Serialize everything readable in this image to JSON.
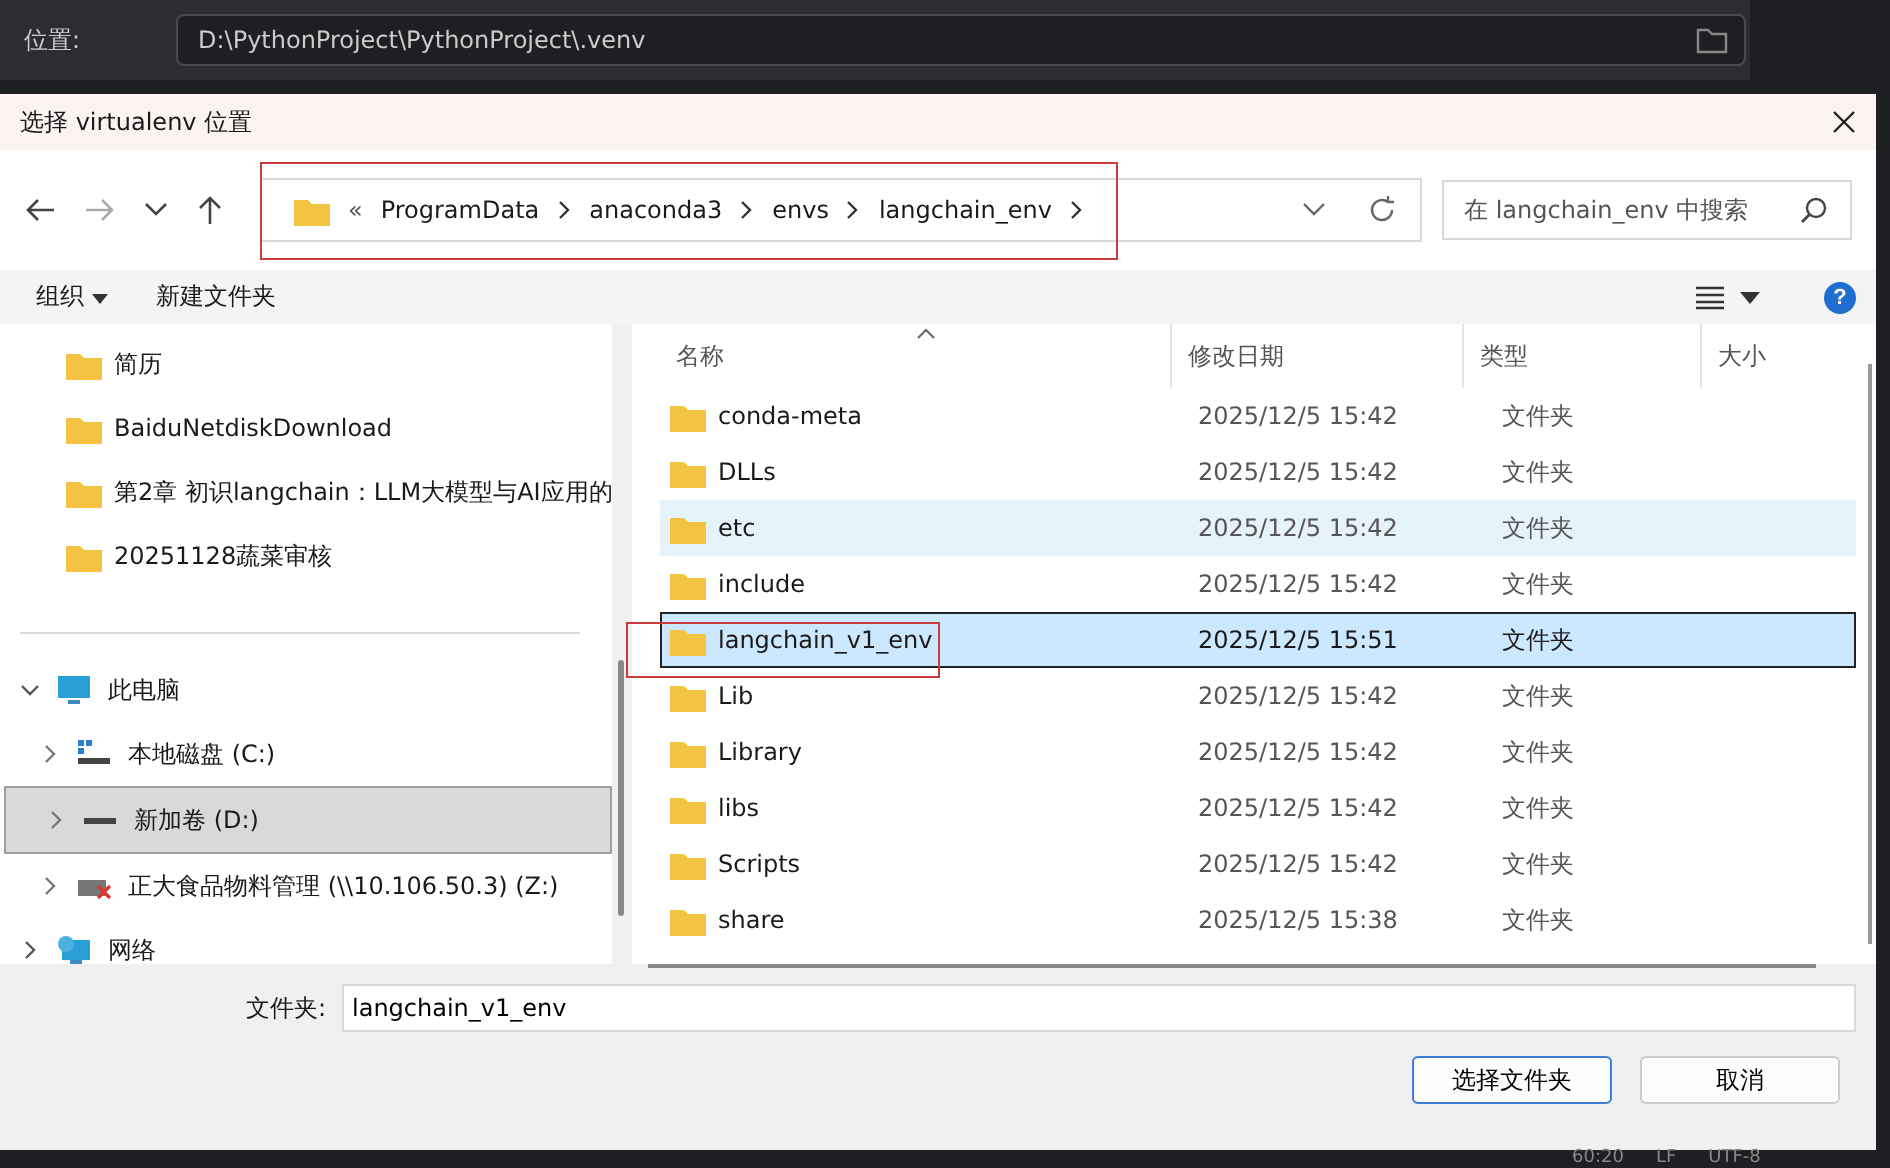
{
  "ide": {
    "location_label": "位置:",
    "location_value": "D:\\PythonProject\\PythonProject\\.venv"
  },
  "dialog": {
    "title": "选择 virtualenv 位置",
    "overflow": "«",
    "breadcrumb": [
      "ProgramData",
      "anaconda3",
      "envs",
      "langchain_env"
    ],
    "search": {
      "placeholder": "在 langchain_env 中搜索"
    },
    "toolbar": {
      "organize": "组织",
      "new_folder": "新建文件夹",
      "help": "?"
    },
    "quick_access": [
      {
        "label": "简历"
      },
      {
        "label": "BaiduNetdiskDownload"
      },
      {
        "label": "第2章 初识langchain：LLM大模型与AI应用的"
      },
      {
        "label": "20251128蔬菜审核"
      }
    ],
    "tree": [
      {
        "label": "此电脑",
        "kind": "pc",
        "expanded": true,
        "selected": false,
        "children": [
          {
            "label": "本地磁盘 (C:)",
            "kind": "system-drive",
            "expanded": false,
            "selected": false
          },
          {
            "label": "新加卷 (D:)",
            "kind": "drive",
            "expanded": false,
            "selected": true
          },
          {
            "label": "正大食品物料管理 (\\\\10.106.50.3) (Z:)",
            "kind": "network-drive",
            "expanded": false,
            "selected": false
          }
        ]
      },
      {
        "label": "网络",
        "kind": "network",
        "expanded": false,
        "selected": false
      }
    ],
    "columns": [
      "名称",
      "修改日期",
      "类型",
      "大小"
    ],
    "rows": [
      {
        "name": "conda-meta",
        "date": "2025/12/5 15:42",
        "type": "文件夹",
        "selected": false,
        "hovered": false
      },
      {
        "name": "DLLs",
        "date": "2025/12/5 15:42",
        "type": "文件夹",
        "selected": false,
        "hovered": false
      },
      {
        "name": "etc",
        "date": "2025/12/5 15:42",
        "type": "文件夹",
        "selected": false,
        "hovered": true
      },
      {
        "name": "include",
        "date": "2025/12/5 15:42",
        "type": "文件夹",
        "selected": false,
        "hovered": false
      },
      {
        "name": "langchain_v1_env",
        "date": "2025/12/5 15:51",
        "type": "文件夹",
        "selected": true,
        "hovered": false
      },
      {
        "name": "Lib",
        "date": "2025/12/5 15:42",
        "type": "文件夹",
        "selected": false,
        "hovered": false
      },
      {
        "name": "Library",
        "date": "2025/12/5 15:42",
        "type": "文件夹",
        "selected": false,
        "hovered": false
      },
      {
        "name": "libs",
        "date": "2025/12/5 15:42",
        "type": "文件夹",
        "selected": false,
        "hovered": false
      },
      {
        "name": "Scripts",
        "date": "2025/12/5 15:42",
        "type": "文件夹",
        "selected": false,
        "hovered": false
      },
      {
        "name": "share",
        "date": "2025/12/5 15:38",
        "type": "文件夹",
        "selected": false,
        "hovered": false
      }
    ],
    "folder_label": "文件夹:",
    "folder_value": "langchain_v1_env",
    "buttons": [
      "选择文件夹",
      "取消"
    ]
  },
  "status_bar": [
    "60:20",
    "LF",
    "UTF-8"
  ]
}
